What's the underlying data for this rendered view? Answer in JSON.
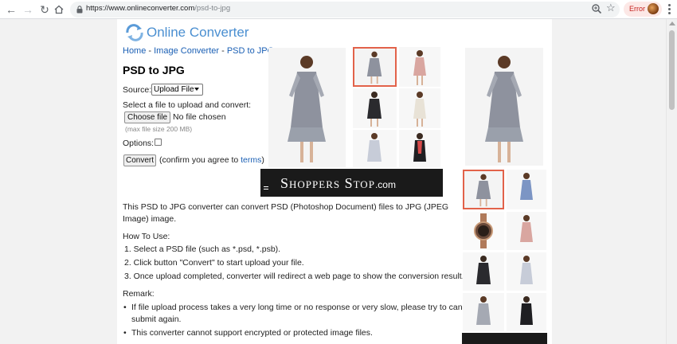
{
  "browser": {
    "url_host": "https://www.onlineconverter.com",
    "url_path": "/psd-to-jpg",
    "error_label": "Error"
  },
  "site": {
    "logo_text": "Online Converter",
    "accent": "#4a8fd1"
  },
  "breadcrumb": {
    "home": "Home",
    "sep1": " - ",
    "image_converter": "Image Converter",
    "sep2": " - ",
    "current": "PSD to JPG"
  },
  "form": {
    "title": "PSD to JPG",
    "source_label": "Source:",
    "source_value": "Upload File",
    "select_label": "Select a file to upload and convert:",
    "choose_button": "Choose file",
    "no_file": "No file chosen",
    "max_size": "(max file size 200 MB)",
    "options_label": "Options:",
    "convert_button": "Convert",
    "confirm_prefix": "(confirm you agree to ",
    "terms_link": "terms",
    "confirm_suffix": ")"
  },
  "content": {
    "description": "This PSD to JPG converter can convert PSD (Photoshop Document) files to JPG (JPEG Image) image.",
    "howto_heading": "How To Use:",
    "steps": [
      "1. Select a PSD file (such as *.psd, *.psb).",
      "2. Click button \"Convert\" to start upload your file.",
      "3. Once upload completed, converter will redirect a web page to show the conversion result."
    ],
    "remark_heading": "Remark:",
    "remarks": [
      "If file upload process takes a very long time or no response or very slow, please try to cancel then",
      "submit again.",
      "This converter cannot support encrypted or protected image files."
    ]
  },
  "ad": {
    "brand_main": "Shoppers Stop",
    "brand_suffix": ".com",
    "selected_border": "#e2624a"
  }
}
